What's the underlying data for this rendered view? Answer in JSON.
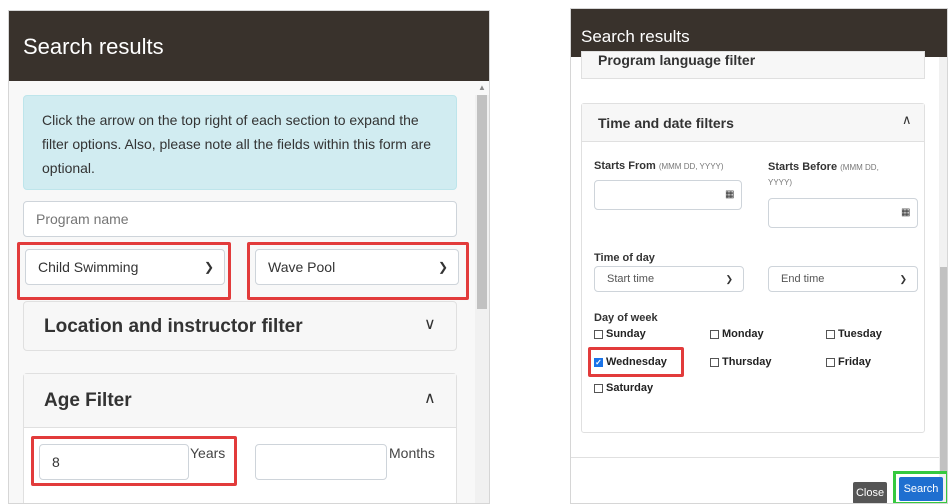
{
  "left": {
    "header_title": "Search results",
    "info_text": "Click the arrow on the top right of each section to expand the filter options. Also, please note all the fields within this form are optional.",
    "program_name_placeholder": "Program name",
    "category_select": "Child Swimming",
    "facility_select": "Wave Pool",
    "location_section_title": "Location and instructor filter",
    "age_section_title": "Age Filter",
    "age_years_value": "8",
    "years_label": "Years",
    "months_label": "Months"
  },
  "right": {
    "header_title": "Search results",
    "language_section_title": "Program language filter",
    "time_section_title": "Time and date filters",
    "starts_from_label": "Starts From",
    "starts_from_format": "(MMM DD, YYYY)",
    "starts_before_label": "Starts Before",
    "starts_before_format_line1": "(MMM DD,",
    "starts_before_format_line2": "YYYY)",
    "time_of_day_label": "Time of day",
    "start_time_select": "Start time",
    "end_time_select": "End time",
    "day_of_week_label": "Day of week",
    "days": {
      "sunday": "Sunday",
      "monday": "Monday",
      "tuesday": "Tuesday",
      "wednesday": "Wednesday",
      "thursday": "Thursday",
      "friday": "Friday",
      "saturday": "Saturday"
    },
    "wednesday_checked": true,
    "close_button": "Close",
    "search_button": "Search"
  },
  "colors": {
    "header_bg": "#39322c",
    "highlight_red": "#e23b3b",
    "highlight_green": "#35c93f",
    "search_button": "#1f6fd0",
    "close_button": "#555555"
  },
  "icons": {
    "chevron_down": "chevron-down-icon",
    "chevron_up": "chevron-up-icon",
    "calendar": "calendar-icon"
  }
}
